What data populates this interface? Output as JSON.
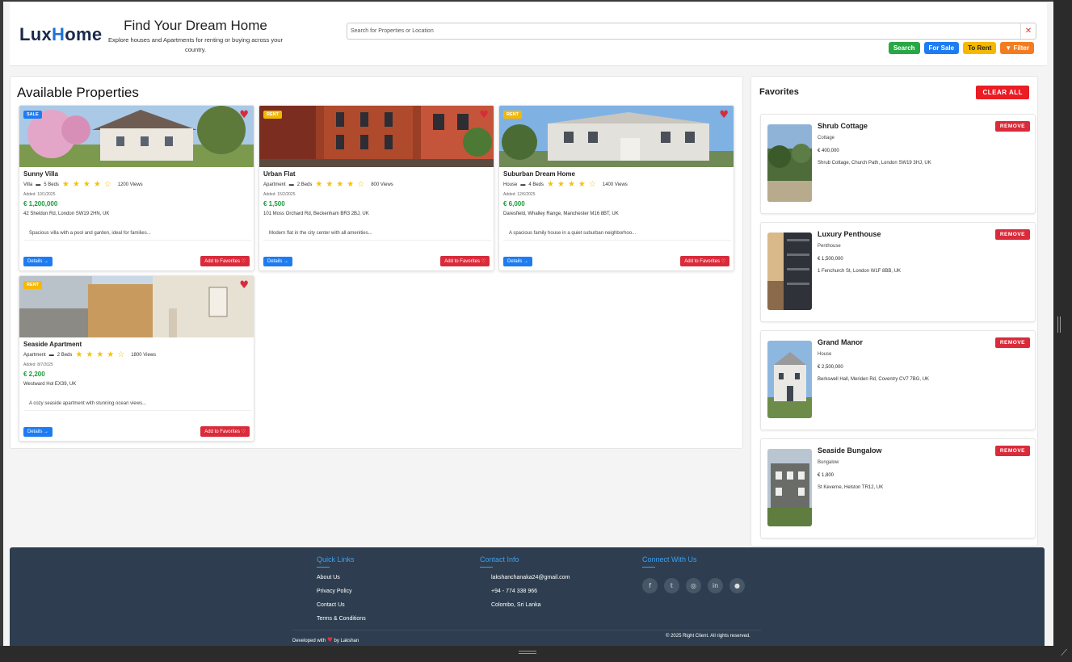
{
  "brand": {
    "logo_left": "Lux",
    "logo_i": "H",
    "logo_right": "ome"
  },
  "hero": {
    "title": "Find Your Dream Home",
    "subtitle": "Explore houses and Apartments for renting or buying across your country."
  },
  "search": {
    "placeholder": "Search for Properties or Location",
    "buttons": {
      "search": "Search",
      "for_sale": "For Sale",
      "to_rent": "To Rent",
      "filter": "▼ Filter"
    }
  },
  "properties": {
    "heading": "Available Properties",
    "details_label": "Details →",
    "favorite_label": "Add to Favorites ♡",
    "items": [
      {
        "badge": "SALE",
        "title": "Sunny Villa",
        "type": "Villa",
        "beds": "5 Beds",
        "rating": 4.5,
        "stars": "★★★★☆",
        "views": "1200 Views",
        "added": "Added: 10/1/2025",
        "price": "€ 1,200,000",
        "address": "42 Sheldon Rd, London SW19 2HN, UK",
        "description": "Spacious villa with a pool and garden, ideal for families...",
        "favorited": true
      },
      {
        "badge": "RENT",
        "title": "Urban Flat",
        "type": "Apartment",
        "beds": "2 Beds",
        "rating": 4.5,
        "stars": "★★★★☆",
        "views": "800 Views",
        "added": "Added: 15/2/2025",
        "price": "€ 1,500",
        "address": "101 Moss Orchard Rd, Beckenham BR3 2BJ, UK",
        "description": "Modern flat in the city center with all amenities...",
        "favorited": true
      },
      {
        "badge": "RENT",
        "title": "Suburban Dream Home",
        "type": "House",
        "beds": "4 Beds",
        "rating": 4.5,
        "stars": "★★★★☆",
        "views": "1400 Views",
        "added": "Added: 12/6/2025",
        "price": "€ 6,000",
        "address": "Daresfield, Whalley Range, Manchester M16 8BT, UK",
        "description": "A spacious family house in a quiet suburban neighborhoo...",
        "favorited": true
      },
      {
        "badge": "RENT",
        "title": "Seaside Apartment",
        "type": "Apartment",
        "beds": "2 Beds",
        "rating": 4.5,
        "stars": "★★★★☆",
        "views": "1800 Views",
        "added": "Added: 8/7/2025",
        "price": "€ 2,200",
        "address": "Westward Hol EX39, UK",
        "description": "A cozy seaside apartment with stunning ocean views...",
        "favorited": true
      }
    ]
  },
  "favorites": {
    "heading": "Favorites",
    "clear_label": "CLEAR ALL",
    "remove_label": "REMOVE",
    "items": [
      {
        "title": "Shrub Cottage",
        "type": "Cottage",
        "price": "€ 400,000",
        "address": "Shrub Cottage, Church Path, London SW19 3HJ, UK"
      },
      {
        "title": "Luxury Penthouse",
        "type": "Penthouse",
        "price": "€ 1,500,000",
        "address": "1 Fenchurch St, London W1F 8BB, UK"
      },
      {
        "title": "Grand Manor",
        "type": "House",
        "price": "€ 2,500,000",
        "address": "Berkswell Hall, Meriden Rd, Coventry CV7 7BG, UK"
      },
      {
        "title": "Seaside Bungalow",
        "type": "Bungalow",
        "price": "€ 1,800",
        "address": "St Keverne, Helston TR12, UK"
      }
    ]
  },
  "footer": {
    "quick_links": {
      "heading": "Quick Links",
      "items": [
        "About Us",
        "Privacy Policy",
        "Contact Us",
        "Terms & Conditions"
      ]
    },
    "contact": {
      "heading": "Contact Info",
      "email": "lakshanchanaka24@gmail.com",
      "phone": "+94 - 774 338 966",
      "location": "Colombo, Sri Lanka"
    },
    "connect": {
      "heading": "Connect With Us",
      "icons": [
        "facebook-icon",
        "twitter-icon",
        "instagram-icon",
        "linkedin-icon",
        "github-icon"
      ]
    },
    "developed_prefix": "Developed with",
    "developed_suffix": "by Lakshan",
    "copyright": "© 2025 Right Client. All rights reserved."
  },
  "colors": {
    "brand_blue": "#1d7cf2",
    "price_green": "#1a9a3a",
    "danger_red": "#d92b3a",
    "footer_bg": "#2e3e50"
  }
}
